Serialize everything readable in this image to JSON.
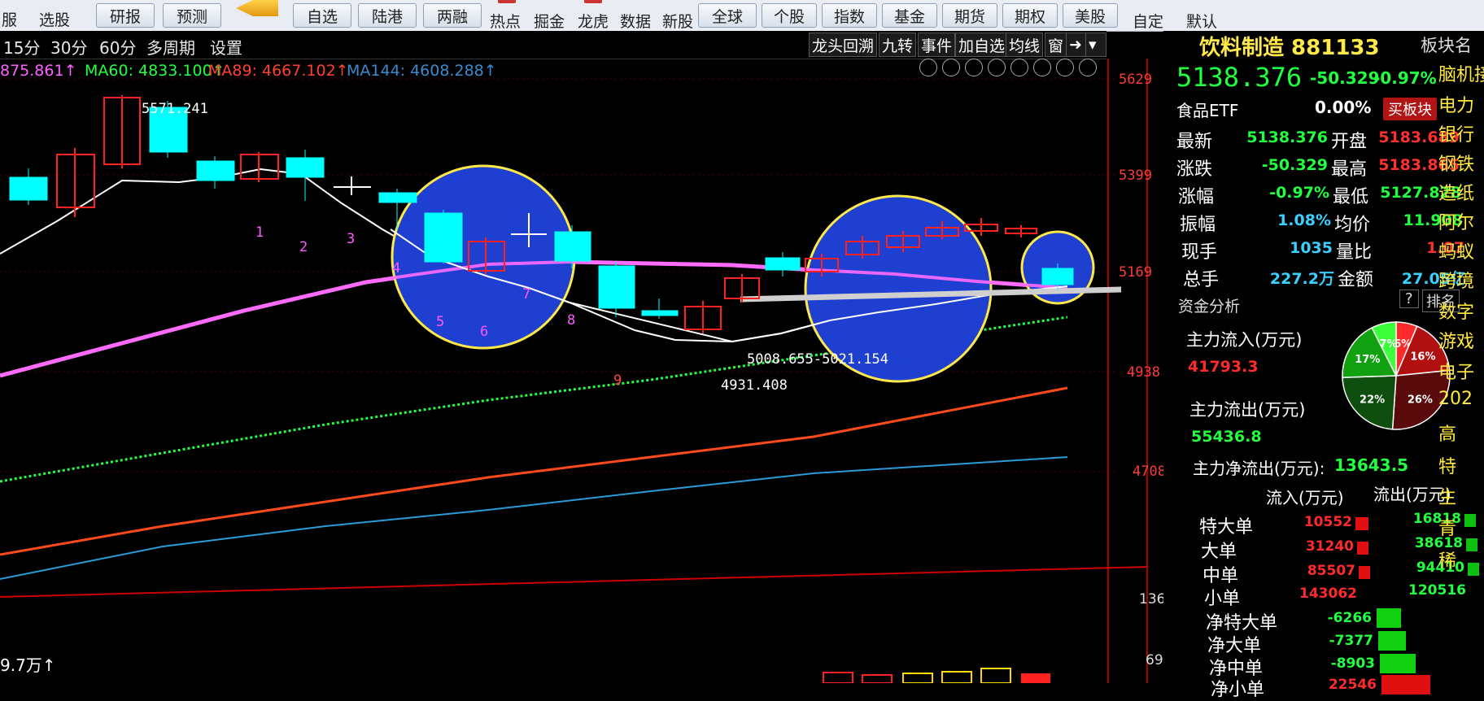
{
  "toolbar": {
    "items": [
      "服",
      "选股",
      "研报",
      "预测",
      "自选",
      "陆港",
      "两融",
      "热点",
      "掘金",
      "龙虎",
      "数据",
      "新股",
      "全球",
      "个股",
      "指数",
      "基金",
      "期货",
      "期权",
      "美股",
      "自定",
      "默认"
    ]
  },
  "chart_toolbar": {
    "periods": [
      "15分",
      "30分",
      "60分",
      "多周期",
      "设置"
    ],
    "right_buttons": [
      "龙头回溯",
      "九转",
      "事件",
      "加自选",
      "均线",
      "窗"
    ]
  },
  "ma": {
    "ma_partial": "875.861↑",
    "ma60": "MA60: 4833.100↑",
    "ma89": "MA89: 4667.102↑",
    "ma144": "MA144: 4608.288↑"
  },
  "y_axis": [
    "5629",
    "5399",
    "5169",
    "4938",
    "4708"
  ],
  "volume_axis": [
    "136",
    "69"
  ],
  "volume_label": "9.7万↑",
  "annotations": {
    "high": "5571.241",
    "low": "4931.408",
    "range": "5008.655-5021.154",
    "counts": [
      "1",
      "2",
      "3",
      "4",
      "5",
      "6",
      "7",
      "8",
      "9"
    ]
  },
  "panel": {
    "name": "饮料制造 881133",
    "price": "5138.376",
    "change": "-50.329",
    "pct": "-0.97%",
    "etf_label": "食品ETF",
    "etf_pct": "0.00%",
    "buy_btn": "买板块",
    "tab_label": "板块名",
    "quote_rows": [
      {
        "l1": "最新",
        "v1": "5138.376",
        "l2": "开盘",
        "v2": "5183.689"
      },
      {
        "l1": "涨跌",
        "v1": "-50.329",
        "l2": "最高",
        "v2": "5183.865"
      },
      {
        "l1": "涨幅",
        "v1": "-0.97%",
        "l2": "最低",
        "v2": "5127.828"
      },
      {
        "l1": "振幅",
        "v1": "1.08%",
        "l2": "均价",
        "v2": "11.908"
      },
      {
        "l1": "现手",
        "v1": "1035",
        "l2": "量比",
        "v2": "1.07"
      },
      {
        "l1": "总手",
        "v1": "227.2万",
        "l2": "金额",
        "v2": "27.05亿"
      }
    ],
    "fund": {
      "title": "资金分析",
      "q": "?",
      "rank": "排名",
      "inflow_label": "主力流入(万元)",
      "inflow": "41793.3",
      "outflow_label": "主力流出(万元)",
      "outflow": "55436.8",
      "net_label": "主力净流出(万元):",
      "net": "13643.5",
      "col_in": "流入(万元)",
      "col_out": "流出(万元)",
      "rows": [
        {
          "label": "特大单",
          "in": "10552",
          "out": "16818"
        },
        {
          "label": "大单",
          "in": "31240",
          "out": "38618"
        },
        {
          "label": "中单",
          "in": "85507",
          "out": "94410"
        },
        {
          "label": "小单",
          "in": "143062",
          "out": "120516"
        }
      ],
      "net_rows": [
        {
          "label": "净特大单",
          "value": "-6266"
        },
        {
          "label": "净大单",
          "value": "-7377"
        },
        {
          "label": "净中单",
          "value": "-8903"
        },
        {
          "label": "净小单",
          "value": "22546"
        }
      ],
      "pie": [
        {
          "pct": "6%",
          "color": "#ff2a2a"
        },
        {
          "pct": "16%",
          "color": "#b01010"
        },
        {
          "pct": "26%",
          "color": "#5a0a0a"
        },
        {
          "pct": "22%",
          "color": "#0d4d0d"
        },
        {
          "pct": "17%",
          "color": "#10a010"
        },
        {
          "pct": "7%",
          "color": "#3cff3c"
        }
      ]
    },
    "sectors": [
      "脑机接",
      "电力",
      "银行",
      "钢铁",
      "造纸",
      "阿尔",
      "蚂蚁",
      "跨境",
      "数字",
      "游戏",
      "电子",
      "202",
      "高",
      "特",
      "生",
      "青",
      "稀"
    ]
  },
  "colors": {
    "up": "#ff2020",
    "down": "#00ffff",
    "ma_white": "#ffffff",
    "ma_pink": "#ff60ff",
    "ma60": "#20ff40",
    "ma89": "#ff5020",
    "ma144": "#2a9ad8",
    "highlight": "#1e3fd0"
  }
}
